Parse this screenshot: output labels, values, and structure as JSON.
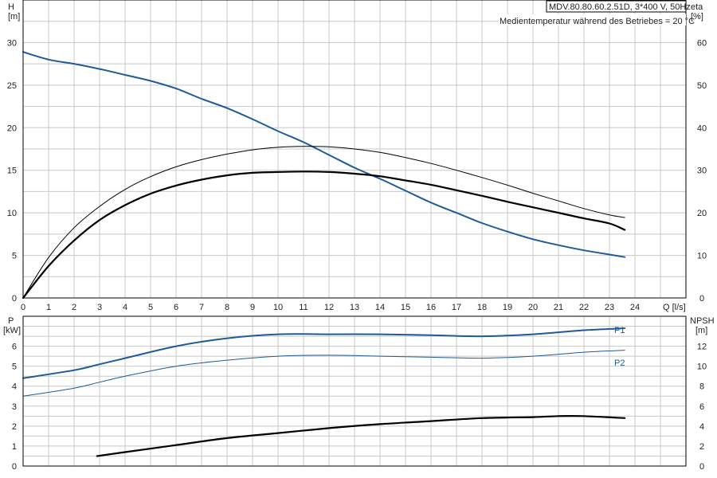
{
  "header": {
    "model": "MDV.80.80.60.2.51D, 3*400 V, 50Hz",
    "subtitle": "Medientemperatur während des Betriebes = 20 °C"
  },
  "chart_data": [
    {
      "type": "line",
      "panel": "top",
      "xlabel": "Q [l/s]",
      "xlim": [
        0,
        26
      ],
      "xticks": [
        0,
        1,
        2,
        3,
        4,
        5,
        6,
        7,
        8,
        9,
        10,
        11,
        12,
        13,
        14,
        15,
        16,
        17,
        18,
        19,
        20,
        21,
        22,
        23,
        24
      ],
      "left_axis": {
        "label_line1": "H",
        "label_line2": "[m]",
        "lim": [
          0,
          35
        ],
        "ticks": [
          0,
          5,
          10,
          15,
          20,
          25,
          30
        ]
      },
      "right_axis": {
        "label_line1": "eta",
        "label_line2": "[%]",
        "lim": [
          0,
          70
        ],
        "ticks": [
          0,
          10,
          20,
          30,
          40,
          50,
          60
        ]
      },
      "grid": true,
      "series": [
        {
          "axis": "left",
          "color": "#1f5b96",
          "width": 2,
          "x": [
            0,
            1,
            2,
            3,
            4,
            5,
            6,
            7,
            8,
            9,
            10,
            11,
            12,
            13,
            14,
            15,
            16,
            17,
            18,
            19,
            20,
            21,
            22,
            23,
            23.6
          ],
          "y": [
            28.9,
            28.0,
            27.5,
            26.9,
            26.2,
            25.5,
            24.6,
            23.4,
            22.3,
            21.0,
            19.6,
            18.3,
            16.8,
            15.3,
            14.0,
            12.6,
            11.2,
            10.0,
            8.8,
            7.8,
            6.9,
            6.2,
            5.6,
            5.1,
            4.8
          ]
        },
        {
          "axis": "right",
          "color": "#000000",
          "width": 1,
          "x": [
            0,
            1,
            2,
            3,
            4,
            5,
            6,
            7,
            8,
            9,
            10,
            11,
            12,
            13,
            14,
            15,
            16,
            17,
            18,
            19,
            20,
            21,
            22,
            23,
            23.6
          ],
          "y": [
            0,
            9.5,
            16.5,
            21.5,
            25.5,
            28.5,
            30.8,
            32.5,
            33.8,
            34.8,
            35.4,
            35.6,
            35.5,
            35.0,
            34.2,
            33.0,
            31.6,
            30.0,
            28.3,
            26.5,
            24.6,
            22.8,
            21.0,
            19.5,
            18.9
          ]
        },
        {
          "axis": "right",
          "color": "#000000",
          "width": 2.2,
          "x": [
            0,
            1,
            2,
            3,
            4,
            5,
            6,
            7,
            8,
            9,
            10,
            11,
            12,
            13,
            14,
            15,
            16,
            17,
            18,
            19,
            20,
            21,
            22,
            23,
            23.6
          ],
          "y": [
            0,
            7.5,
            13.5,
            18.3,
            21.8,
            24.5,
            26.4,
            27.8,
            28.8,
            29.4,
            29.6,
            29.7,
            29.6,
            29.2,
            28.6,
            27.6,
            26.6,
            25.3,
            24.0,
            22.6,
            21.3,
            20.0,
            18.7,
            17.5,
            16.0
          ]
        }
      ]
    },
    {
      "type": "line",
      "panel": "bottom",
      "xlim": [
        0,
        26
      ],
      "left_axis": {
        "label_line1": "P",
        "label_line2": "[kW]",
        "lim": [
          0,
          7.5
        ],
        "ticks": [
          0,
          1,
          2,
          3,
          4,
          5,
          6
        ]
      },
      "right_axis": {
        "label_line1": "NPSH",
        "label_line2": "[m]",
        "lim": [
          0,
          15
        ],
        "ticks": [
          0,
          2,
          4,
          6,
          8,
          10,
          12
        ]
      },
      "grid": true,
      "series": [
        {
          "name": "P1",
          "axis": "left",
          "color": "#1f5b96",
          "width": 2,
          "x": [
            0,
            2,
            3,
            4,
            6,
            8,
            10,
            12,
            14,
            16,
            18,
            20,
            22,
            23.6
          ],
          "y": [
            4.4,
            4.8,
            5.1,
            5.4,
            6.0,
            6.4,
            6.6,
            6.6,
            6.6,
            6.55,
            6.5,
            6.6,
            6.8,
            6.9
          ]
        },
        {
          "name": "P2",
          "axis": "left",
          "color": "#1f5b96",
          "width": 1,
          "x": [
            0,
            2,
            3,
            4,
            6,
            8,
            10,
            12,
            14,
            16,
            18,
            20,
            22,
            23.6
          ],
          "y": [
            3.5,
            3.9,
            4.2,
            4.5,
            5.0,
            5.3,
            5.5,
            5.55,
            5.5,
            5.45,
            5.4,
            5.5,
            5.7,
            5.8
          ]
        },
        {
          "axis": "right",
          "color": "#000000",
          "width": 2.2,
          "x": [
            2.9,
            4,
            6,
            8,
            10,
            12,
            14,
            16,
            18,
            20,
            21,
            22,
            23.6
          ],
          "y": [
            1.0,
            1.4,
            2.1,
            2.8,
            3.3,
            3.8,
            4.2,
            4.5,
            4.8,
            4.9,
            5.0,
            5.0,
            4.8
          ]
        }
      ]
    }
  ]
}
